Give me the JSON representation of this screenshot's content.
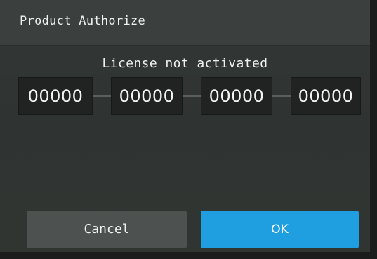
{
  "window": {
    "title": "Product Authorize"
  },
  "status": {
    "text": "License not activated"
  },
  "license_code": {
    "segments": [
      "00000",
      "00000",
      "00000",
      "00000"
    ]
  },
  "buttons": {
    "cancel_label": "Cancel",
    "ok_label": "OK"
  },
  "colors": {
    "background": "#303532",
    "titlebar": "#3b403e",
    "field": "#202322",
    "cancel_button": "#4d5250",
    "ok_button": "#1f9fe0",
    "text": "#eef1ef"
  }
}
